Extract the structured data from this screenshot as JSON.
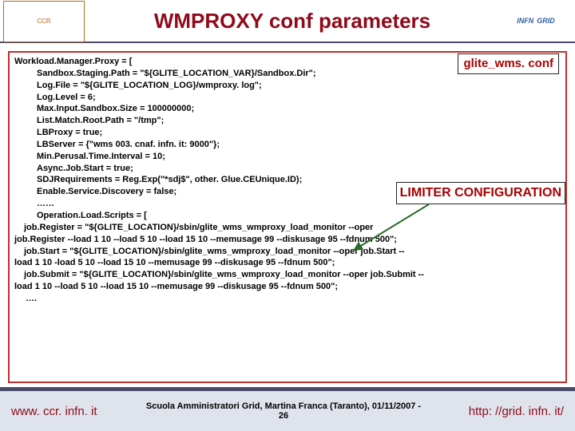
{
  "title": "WMPROXY conf parameters",
  "logo_left": "CCR",
  "logo_right_a": "INFN",
  "logo_right_b": "GRID",
  "label1": "glite_wms. conf",
  "label2": "LIMITER CONFIGURATION",
  "c": {
    "l1": "Workload.Manager.Proxy = [",
    "l2": "Sandbox.Staging.Path = \"${GLITE_LOCATION_VAR}/Sandbox.Dir\";",
    "l3": "Log.File = \"${GLITE_LOCATION_LOG}/wmproxy. log\";",
    "l4": "Log.Level = 6;",
    "l5": "Max.Input.Sandbox.Size = 100000000;",
    "l6": "List.Match.Root.Path = \"/tmp\";",
    "l7": "LBProxy = true;",
    "l8": "LBServer = {\"wms 003. cnaf. infn. it: 9000\"};",
    "l9": "Min.Perusal.Time.Interval = 10;",
    "l10": "Async.Job.Start = true;",
    "l11": "SDJRequirements = Reg.Exp(\"*sdj$\", other. Glue.CEUnique.ID);",
    "l12": "Enable.Service.Discovery = false;",
    "l13": "……",
    "l14": "Operation.Load.Scripts = [",
    "l15a": " job.Register = \"${GLITE_LOCATION}/sbin/glite_wms_wmproxy_load_monitor --oper",
    "l15b": "job.Register --load 1 10 --load 5 10 --load 15 10 --memusage 99 --diskusage 95 --fdnum 500\";",
    "l16a": " job.Start = \"${GLITE_LOCATION}/sbin/glite_wms_wmproxy_load_monitor --oper job.Start --",
    "l16b": "load 1 10 -load 5 10 --load 15 10 --memusage 99 --diskusage 95 --fdnum 500\";",
    "l17a": " job.Submit = \"${GLITE_LOCATION}/sbin/glite_wms_wmproxy_load_monitor --oper job.Submit --",
    "l17b": "load 1 10 --load 5 10 --load 15 10 --memusage 99 --diskusage 95 --fdnum 500\";",
    "l18": "…."
  },
  "footer_left": "www. ccr. infn. it",
  "footer_center_a": "Scuola Amministratori Grid, Martina Franca (Taranto), 01/11/2007 -",
  "footer_center_b": "26",
  "footer_right": "http: //grid. infn. it/"
}
